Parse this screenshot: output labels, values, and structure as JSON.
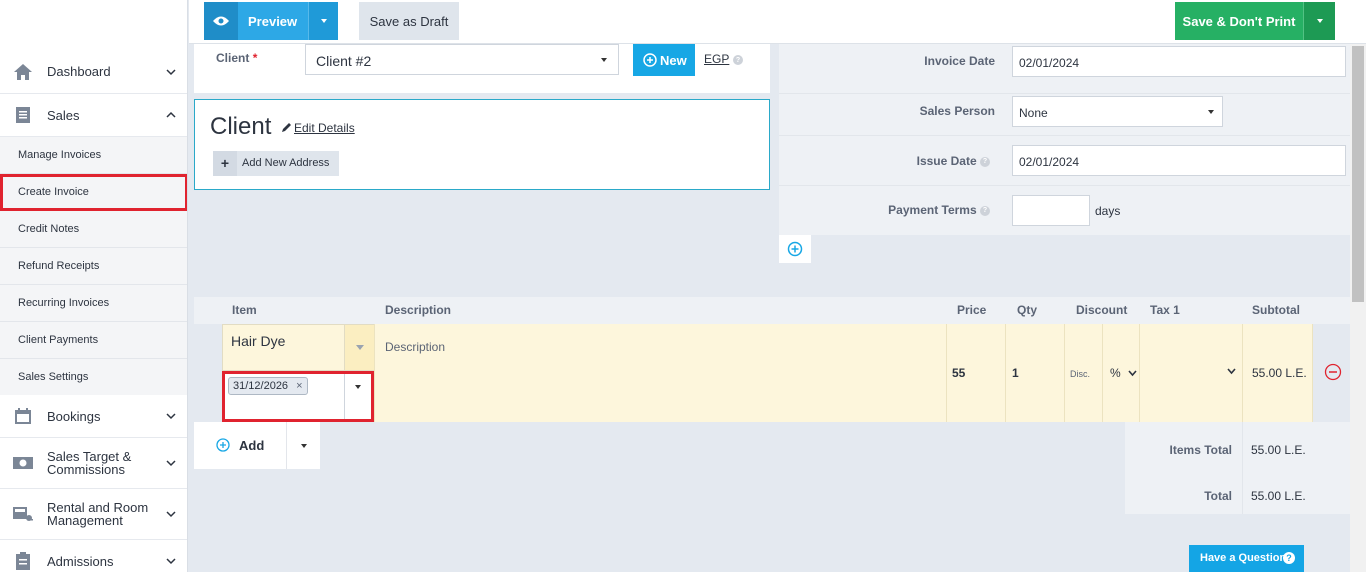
{
  "toolbar": {
    "preview_label": "Preview",
    "save_draft_label": "Save as Draft",
    "save_label": "Save & Don't Print"
  },
  "sidebar": {
    "items": [
      {
        "label": "Dashboard",
        "icon": "home-icon"
      },
      {
        "label": "Sales",
        "icon": "invoice-icon"
      },
      {
        "label": "Bookings",
        "icon": "calendar-icon"
      },
      {
        "label": "Sales Target & Commissions",
        "icon": "money-icon"
      },
      {
        "label": "Rental and Room Management",
        "icon": "rental-icon"
      },
      {
        "label": "Admissions",
        "icon": "clipboard-icon"
      }
    ],
    "sales_submenu": [
      "Manage Invoices",
      "Create Invoice",
      "Credit Notes",
      "Refund Receipts",
      "Recurring Invoices",
      "Client Payments",
      "Sales Settings"
    ],
    "labels": {
      "dashboard": "Dashboard",
      "sales": "Sales",
      "bookings": "Bookings",
      "sales_target_1": "Sales Target &",
      "sales_target_2": "Commissions",
      "rental_1": "Rental and Room",
      "rental_2": "Management",
      "admissions": "Admissions"
    }
  },
  "client": {
    "label": "Client",
    "required_mark": "*",
    "selected": "Client #2",
    "new_label": "New",
    "currency": "EGP",
    "card_title": "Client",
    "edit_details": "Edit Details",
    "add_address": "Add New Address"
  },
  "invoice_meta": {
    "invoice_date_label": "Invoice Date",
    "invoice_date": "02/01/2024",
    "sales_person_label": "Sales Person",
    "sales_person": "None",
    "issue_date_label": "Issue Date",
    "issue_date": "02/01/2024",
    "payment_terms_label": "Payment Terms",
    "payment_terms_value": "",
    "payment_terms_unit": "days"
  },
  "items_table": {
    "headers": {
      "item": "Item",
      "description": "Description",
      "price": "Price",
      "qty": "Qty",
      "discount": "Discount",
      "tax1": "Tax 1",
      "subtotal": "Subtotal"
    },
    "rows": [
      {
        "item": "Hair Dye",
        "lot_tag": "31/12/2026",
        "description_placeholder": "Description",
        "price": "55",
        "qty": "1",
        "discount_placeholder": "Disc.",
        "discount_type": "%",
        "tax1": "",
        "subtotal": "55.00 L.E."
      }
    ],
    "add_label": "Add"
  },
  "totals": {
    "items_total_label": "Items Total",
    "items_total": "55.00 L.E.",
    "total_label": "Total",
    "total": "55.00 L.E."
  },
  "help": {
    "question_label": "Have a Question"
  },
  "colors": {
    "accent": "#17a7e5",
    "save_green": "#26b064",
    "highlight_red": "#e0232f",
    "item_row_bg": "#fdf6dc"
  }
}
